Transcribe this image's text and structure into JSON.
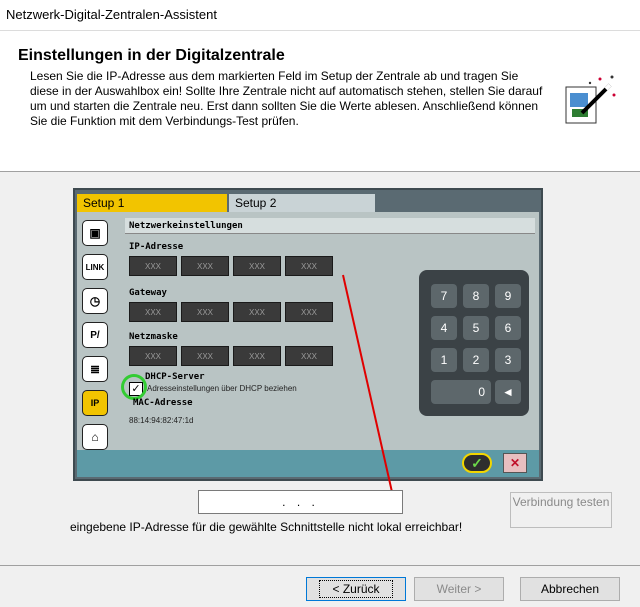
{
  "window": {
    "title": "Netzwerk-Digital-Zentralen-Assistent"
  },
  "header": {
    "title": "Einstellungen in der Digitalzentrale",
    "description": "Lesen Sie die IP-Adresse aus dem markierten Feld im Setup der Zentrale ab und tragen Sie diese in der Auswahlbox ein! Sollte Ihre Zentrale nicht auf automatisch stehen, stellen Sie darauf um und starten die Zentrale neu. Erst dann sollten Sie die Werte ablesen. Anschließend können Sie die Funktion mit dem Verbindungs-Test prüfen."
  },
  "device": {
    "tabs": [
      "Setup 1",
      "Setup 2"
    ],
    "section_title": "Netzwerkeinstellungen",
    "fields": [
      {
        "label": "IP-Adresse",
        "values": [
          "XXX",
          "XXX",
          "XXX",
          "XXX"
        ]
      },
      {
        "label": "Gateway",
        "values": [
          "XXX",
          "XXX",
          "XXX",
          "XXX"
        ]
      },
      {
        "label": "Netzmaske",
        "values": [
          "XXX",
          "XXX",
          "XXX",
          "XXX"
        ]
      }
    ],
    "dhcp_label": "DHCP-Server",
    "dhcp_option": "Adresseinstellungen über DHCP beziehen",
    "dhcp_checked": true,
    "mac_label": "MAC-Adresse",
    "mac_value": "88:14:94:82:47:1d",
    "numpad": [
      "7",
      "8",
      "9",
      "4",
      "5",
      "6",
      "1",
      "2",
      "3",
      "0",
      "◄"
    ],
    "side_icons": [
      "slot-icon",
      "link-icon",
      "clock-icon",
      "feedback-icon",
      "grid-icon",
      "ip-icon",
      "factory-icon"
    ]
  },
  "ip_input": {
    "value": ".     .     ."
  },
  "test_button": {
    "label": "Verbindung testen"
  },
  "status_message": "eingebene IP-Adresse für die gewählte Schnittstelle nicht lokal erreichbar!",
  "buttons": {
    "back": "< Zurück",
    "next": "Weiter >",
    "cancel": "Abbrechen"
  }
}
